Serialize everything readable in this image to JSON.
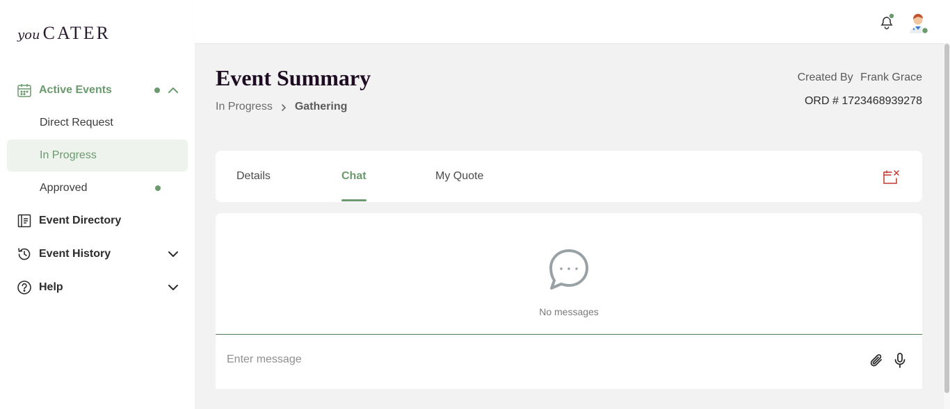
{
  "brand": {
    "logo_small": "you",
    "logo_large": "CATER"
  },
  "sidebar": {
    "active_events": {
      "label": "Active Events",
      "icon": "calendar-icon",
      "expanded": true
    },
    "sub_items": [
      {
        "label": "Direct Request"
      },
      {
        "label": "In Progress",
        "active": true
      },
      {
        "label": "Approved",
        "has_dot": true
      }
    ],
    "items": [
      {
        "label": "Event Directory",
        "icon": "directory-icon"
      },
      {
        "label": "Event History",
        "icon": "history-icon"
      },
      {
        "label": "Help",
        "icon": "help-icon"
      }
    ]
  },
  "header": {
    "icons": [
      "bell-icon",
      "user-avatar"
    ]
  },
  "page": {
    "title": "Event Summary",
    "breadcrumb": {
      "parent": "In Progress",
      "current": "Gathering"
    },
    "created_by_label": "Created By",
    "created_by_name": "Frank Grace",
    "order": "ORD # 1723468939278"
  },
  "tabs": [
    {
      "label": "Details"
    },
    {
      "label": "Chat",
      "active": true
    },
    {
      "label": "My Quote"
    }
  ],
  "chat": {
    "empty_text": "No messages",
    "input_placeholder": "Enter message"
  },
  "colors": {
    "accent": "#6a9a6d",
    "danger": "#c0392b",
    "title": "#1e0d22"
  }
}
